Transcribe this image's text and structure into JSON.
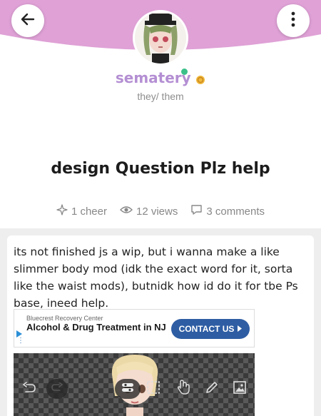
{
  "header": {
    "back_icon": "back-arrow-icon",
    "more_icon": "more-vertical-icon",
    "band_color": "#dfa1d6"
  },
  "profile": {
    "username": "sematery",
    "pronouns": "they/ them",
    "badge_icon": "gold-badge-icon",
    "online": true,
    "username_color": "#b48fd3"
  },
  "post": {
    "title": "design Question Plz help",
    "stats": {
      "cheers": "1 cheer",
      "views": "12 views",
      "comments": "3 comments"
    },
    "body": "its not finished js a wip, but i wanna make a like slimmer body mod (idk the exact word for it, sorta like the waist mods), butnidk how id do it for tbe Ps base, ineed help."
  },
  "ad": {
    "sponsor": "Bluecrest Recovery Center",
    "title": "Alcohol & Drug Treatment in NJ",
    "cta": "CONTACT US",
    "cta_color": "#2e5da3"
  },
  "editor_toolbar": {
    "icons": [
      "undo-icon",
      "redo-icon",
      "toggle-icon",
      "select-icon",
      "hand-icon",
      "pencil-icon",
      "image-icon"
    ]
  }
}
